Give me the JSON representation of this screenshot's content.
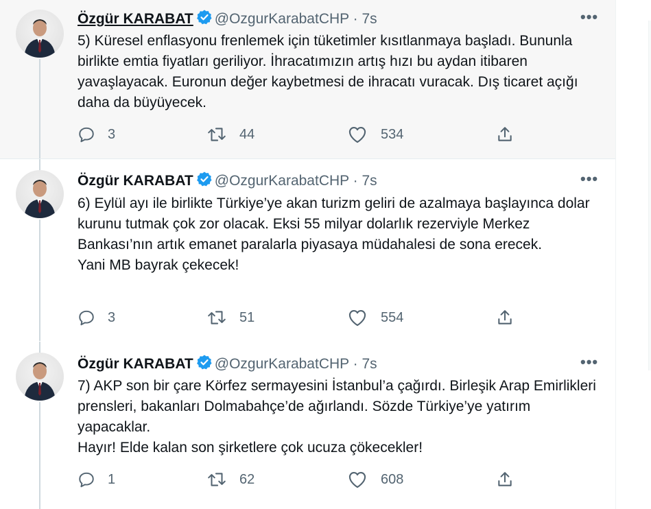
{
  "author": {
    "name": "Özgür KARABAT",
    "handle": "@OzgurKarabatCHP"
  },
  "separator": "·",
  "more_label": "•••",
  "tweets": [
    {
      "time": "7s",
      "text": "5) Küresel enflasyonu frenlemek için tüketimler kısıtlanmaya başladı. Bununla birlikte emtia fiyatları geriliyor. İhracatımızın artış hızı bu aydan itibaren yavaşlayacak. Euronun değer kaybetmesi de ihracatı vuracak. Dış ticaret açığı daha da büyüyecek.",
      "replies": "3",
      "retweets": "44",
      "likes": "534"
    },
    {
      "time": "7s",
      "text": "6) Eylül ayı ile birlikte Türkiye’ye akan turizm geliri de azalmaya başlayınca dolar kurunu tutmak çok zor olacak. Eksi 55 milyar dolarlık rezerviyle Merkez Bankası’nın artık emanet paralarla piyasaya müdahalesi de sona erecek.\nYani MB bayrak çekecek!",
      "replies": "3",
      "retweets": "51",
      "likes": "554"
    },
    {
      "time": "7s",
      "text": "7) AKP son bir çare Körfez sermayesini İstanbul’a çağırdı. Birleşik Arap Emirlikleri prensleri, bakanları Dolmabahçe’de ağırlandı. Sözde Türkiye’ye yatırım yapacaklar.\nHayır! Elde kalan son şirketlere çok ucuza çökecekler!",
      "replies": "1",
      "retweets": "62",
      "likes": "608"
    }
  ],
  "colors": {
    "verified": "#1d9bf0",
    "muted": "#536471",
    "thread_line": "#cfd9de",
    "highlight_bg": "#f7f7f7"
  }
}
